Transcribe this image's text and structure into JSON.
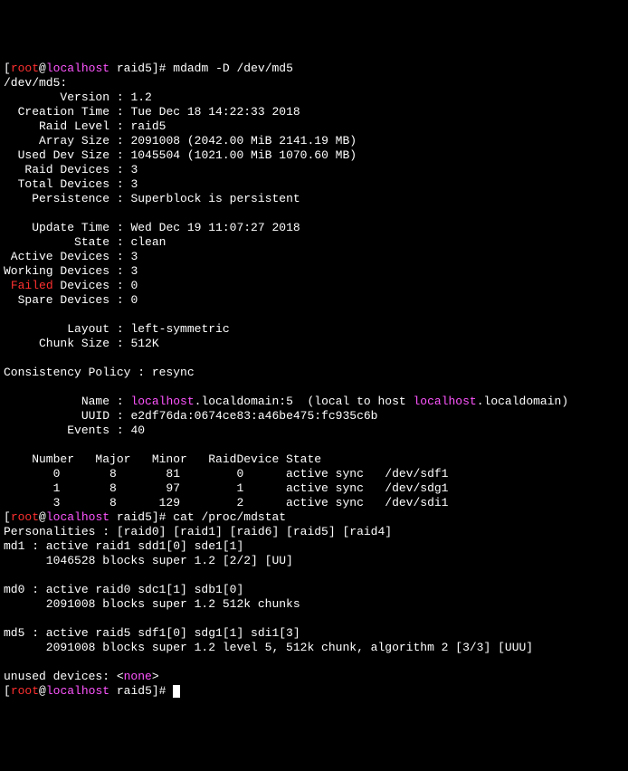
{
  "prompt1": {
    "lbracket": "[",
    "user": "root",
    "at": "@",
    "host": "localhost",
    "path": " raid5]# ",
    "cmd": "mdadm -D /dev/md5"
  },
  "dev_line": "/dev/md5:",
  "fields": {
    "version_l": "        Version : ",
    "version_v": "1.2",
    "ctime_l": "  Creation Time : ",
    "ctime_v": "Tue Dec 18 14:22:33 2018",
    "rlevel_l": "     Raid Level : ",
    "rlevel_v": "raid5",
    "asize_l": "     Array Size : ",
    "asize_v": "2091008 (2042.00 MiB 2141.19 MB)",
    "usize_l": "  Used Dev Size : ",
    "usize_v": "1045504 (1021.00 MiB 1070.60 MB)",
    "rdev_l": "   Raid Devices : ",
    "rdev_v": "3",
    "tdev_l": "  Total Devices : ",
    "tdev_v": "3",
    "pers_l": "    Persistence : ",
    "pers_v": "Superblock is persistent",
    "utime_l": "    Update Time : ",
    "utime_v": "Wed Dec 19 11:07:27 2018",
    "state_l": "          State : ",
    "state_v": "clean",
    "adev_l": " Active Devices : ",
    "adev_v": "3",
    "wdev_l": "Working Devices : ",
    "wdev_v": "3",
    "fdev_pre": " ",
    "fdev_red": "Failed",
    "fdev_post": " Devices : ",
    "fdev_v": "0",
    "sdev_l": "  Spare Devices : ",
    "sdev_v": "0",
    "layout_l": "         Layout : ",
    "layout_v": "left-symmetric",
    "chunk_l": "     Chunk Size : ",
    "chunk_v": "512K",
    "cpol_l": "Consistency Policy : ",
    "cpol_v": "resync",
    "name_l": "           Name : ",
    "name_host1": "localhost",
    "name_mid": ".localdomain:5  (local to host ",
    "name_host2": "localhost",
    "name_end": ".localdomain)",
    "uuid_l": "           UUID : ",
    "uuid_v": "e2df76da:0674ce83:a46be475:fc935c6b",
    "events_l": "         Events : ",
    "events_v": "40"
  },
  "dev_header": "    Number   Major   Minor   RaidDevice State",
  "dev_rows": {
    "r0": "       0       8       81        0      active sync   /dev/sdf1",
    "r1": "       1       8       97        1      active sync   /dev/sdg1",
    "r2": "       3       8      129        2      active sync   /dev/sdi1"
  },
  "prompt2": {
    "lbracket": "[",
    "user": "root",
    "at": "@",
    "host": "localhost",
    "path": " raid5]# ",
    "cmd": "cat /proc/mdstat"
  },
  "mdstat": {
    "pers": "Personalities : [raid0] [raid1] [raid6] [raid5] [raid4]",
    "md1a": "md1 : active raid1 sdd1[0] sde1[1]",
    "md1b": "      1046528 blocks super 1.2 [2/2] [UU]",
    "md0a": "md0 : active raid0 sdc1[1] sdb1[0]",
    "md0b": "      2091008 blocks super 1.2 512k chunks",
    "md5a": "md5 : active raid5 sdf1[0] sdg1[1] sdi1[3]",
    "md5b": "      2091008 blocks super 1.2 level 5, 512k chunk, algorithm 2 [3/3] [UUU]",
    "unused_pre": "unused devices: <",
    "unused_none": "none",
    "unused_post": ">"
  },
  "prompt3": {
    "lbracket": "[",
    "user": "root",
    "at": "@",
    "host": "localhost",
    "path": " raid5]# "
  }
}
